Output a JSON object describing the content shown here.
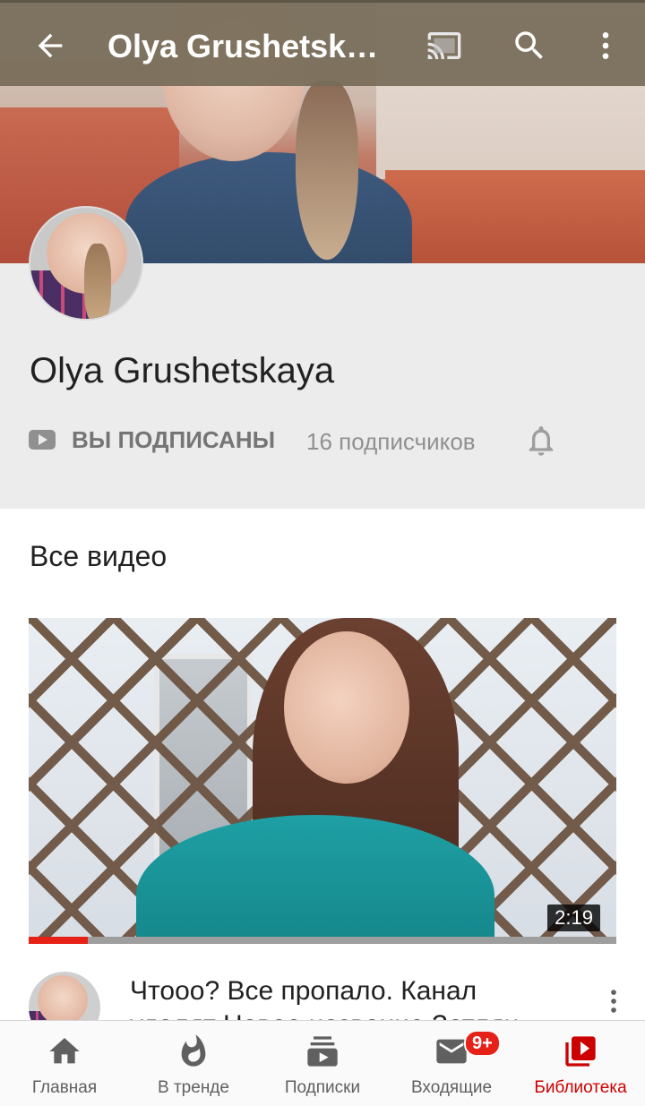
{
  "app_bar": {
    "title": "Olya Grushetskaya",
    "icons": [
      "back-arrow-icon",
      "cast-icon",
      "search-icon",
      "more-vert-icon"
    ]
  },
  "channel": {
    "name": "Olya Grushetskaya",
    "subscribe_state": "ВЫ ПОДПИСАНЫ",
    "subscribers": "16 подписчиков",
    "icons": [
      "youtube-play-icon",
      "notification-bell-icon"
    ]
  },
  "section": {
    "title": "Все видео"
  },
  "video": {
    "duration": "2:19",
    "watched_fraction": 0.1,
    "title": "Чтооо?  Все пропало. Канал удалят Новое название Зетлян"
  },
  "bottom_nav": {
    "items": [
      {
        "label": "Главная",
        "icon": "home-icon"
      },
      {
        "label": "В тренде",
        "icon": "trending-flame-icon"
      },
      {
        "label": "Подписки",
        "icon": "subscriptions-icon"
      },
      {
        "label": "Входящие",
        "icon": "inbox-mail-icon",
        "badge": "9+"
      },
      {
        "label": "Библиотека",
        "icon": "library-icon"
      }
    ],
    "active_index": 4
  },
  "colors": {
    "app_bar": "#766b58",
    "accent_red": "#e62117",
    "active_nav": "#cc0000",
    "channel_bg": "#ececec"
  }
}
